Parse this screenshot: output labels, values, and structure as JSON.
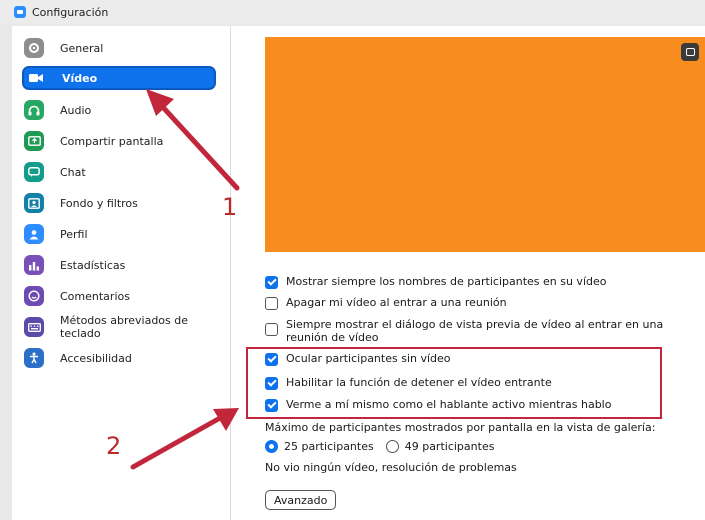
{
  "window": {
    "title": "Configuración"
  },
  "sidebar": {
    "items": [
      {
        "label": "General",
        "icon": "gear-icon",
        "color": "#8e8e8e"
      },
      {
        "label": "Vídeo",
        "icon": "video-camera-icon",
        "color": "#0e72ed",
        "active": true
      },
      {
        "label": "Audio",
        "icon": "headphones-icon",
        "color": "#27a862"
      },
      {
        "label": "Compartir pantalla",
        "icon": "share-screen-icon",
        "color": "#1f9a54"
      },
      {
        "label": "Chat",
        "icon": "chat-bubble-icon",
        "color": "#129c8a"
      },
      {
        "label": "Fondo y filtros",
        "icon": "background-filter-icon",
        "color": "#1380a8"
      },
      {
        "label": "Perfil",
        "icon": "profile-icon",
        "color": "#2d8cff"
      },
      {
        "label": "Estadísticas",
        "icon": "statistics-icon",
        "color": "#7b4fb8"
      },
      {
        "label": "Comentarios",
        "icon": "feedback-smiley-icon",
        "color": "#6d4bb3"
      },
      {
        "label": "Métodos abreviados de teclado",
        "icon": "keyboard-icon",
        "color": "#5b4aa8"
      },
      {
        "label": "Accesibilidad",
        "icon": "accessibility-icon",
        "color": "#2b6fc9"
      }
    ]
  },
  "main": {
    "preview_color": "#f98c1e",
    "options": [
      {
        "label": "Mostrar siempre los nombres de participantes en su vídeo",
        "checked": true
      },
      {
        "label": "Apagar mi vídeo al entrar a una reunión",
        "checked": false
      },
      {
        "label": "Siempre mostrar el diálogo de vista previa de vídeo al entrar en una reunión de vídeo",
        "checked": false
      },
      {
        "label": "Ocular participantes sin vídeo",
        "checked": true
      },
      {
        "label": "Habilitar la función de detener el vídeo entrante",
        "checked": true
      },
      {
        "label": "Verme a mí mismo como el hablante activo mientras hablo",
        "checked": true
      }
    ],
    "gallery_label": "Máximo de participantes mostrados por pantalla en la vista de galería:",
    "radio_options": [
      {
        "label": "25 participantes",
        "selected": true
      },
      {
        "label": "49 participantes",
        "selected": false
      }
    ],
    "troubleshoot_text": "No vio ningún vídeo, resolución de problemas",
    "advanced_button": "Avanzado"
  },
  "annotations": {
    "label_1": "1",
    "label_2": "2",
    "color": "#c2263a"
  }
}
